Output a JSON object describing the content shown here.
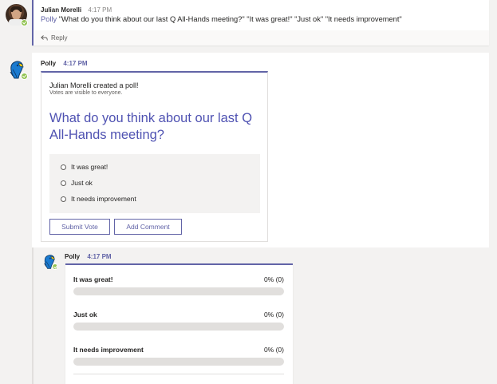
{
  "thread": {
    "root_message": {
      "author": "Julian Morelli",
      "time": "4:17 PM",
      "mention": "Polly",
      "text": " \"What do you think about our last Q All-Hands meeting?\" \"It was great!\" \"Just ok\" \"It needs improvement\"",
      "reply_label": "Reply"
    }
  },
  "poll_message": {
    "author": "Polly",
    "time": "4:17 PM",
    "creator_text": "Julian Morelli created a poll!",
    "visibility_text": "Votes are visible to everyone.",
    "question": "What do you think about our last Q All-Hands meeting?",
    "options": [
      "It was great!",
      "Just ok",
      "It needs improvement"
    ],
    "submit_label": "Submit Vote",
    "comment_label": "Add Comment"
  },
  "results_message": {
    "author": "Polly",
    "time": "4:17 PM",
    "results": [
      {
        "label": "It was great!",
        "percent_text": "0% (0)",
        "fraction": 0
      },
      {
        "label": "Just ok",
        "percent_text": "0% (0)",
        "fraction": 0
      },
      {
        "label": "It needs improvement",
        "percent_text": "0% (0)",
        "fraction": 0
      }
    ]
  },
  "colors": {
    "accent": "#6264a7",
    "presence": "#92c353",
    "bot_blue": "#1a7bd1"
  },
  "icons": {
    "reply": "reply-arrow-icon",
    "bot": "polly-parrot-icon",
    "presence": "available-check-icon"
  }
}
